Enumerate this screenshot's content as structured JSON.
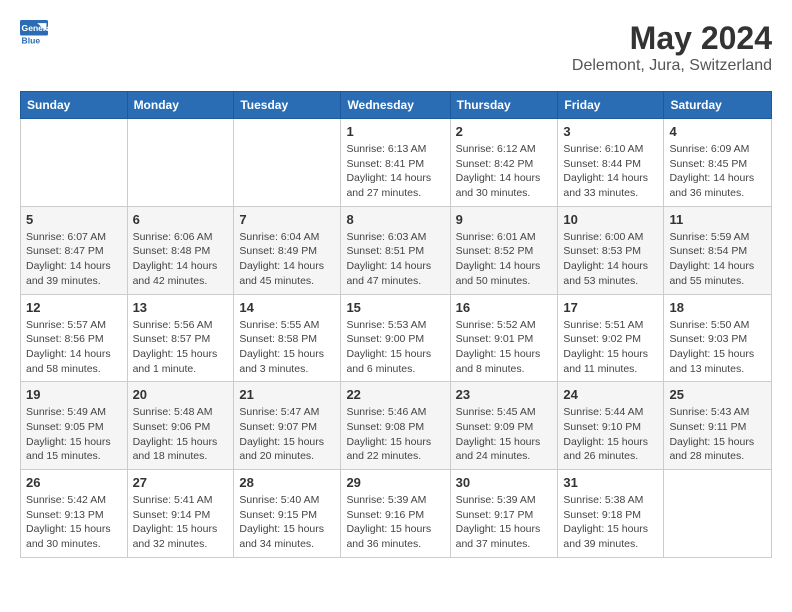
{
  "logo": {
    "general": "General",
    "blue": "Blue"
  },
  "title": "May 2024",
  "subtitle": "Delemont, Jura, Switzerland",
  "days_header": [
    "Sunday",
    "Monday",
    "Tuesday",
    "Wednesday",
    "Thursday",
    "Friday",
    "Saturday"
  ],
  "weeks": [
    [
      {
        "day": "",
        "info": ""
      },
      {
        "day": "",
        "info": ""
      },
      {
        "day": "",
        "info": ""
      },
      {
        "day": "1",
        "info": "Sunrise: 6:13 AM\nSunset: 8:41 PM\nDaylight: 14 hours\nand 27 minutes."
      },
      {
        "day": "2",
        "info": "Sunrise: 6:12 AM\nSunset: 8:42 PM\nDaylight: 14 hours\nand 30 minutes."
      },
      {
        "day": "3",
        "info": "Sunrise: 6:10 AM\nSunset: 8:44 PM\nDaylight: 14 hours\nand 33 minutes."
      },
      {
        "day": "4",
        "info": "Sunrise: 6:09 AM\nSunset: 8:45 PM\nDaylight: 14 hours\nand 36 minutes."
      }
    ],
    [
      {
        "day": "5",
        "info": "Sunrise: 6:07 AM\nSunset: 8:47 PM\nDaylight: 14 hours\nand 39 minutes."
      },
      {
        "day": "6",
        "info": "Sunrise: 6:06 AM\nSunset: 8:48 PM\nDaylight: 14 hours\nand 42 minutes."
      },
      {
        "day": "7",
        "info": "Sunrise: 6:04 AM\nSunset: 8:49 PM\nDaylight: 14 hours\nand 45 minutes."
      },
      {
        "day": "8",
        "info": "Sunrise: 6:03 AM\nSunset: 8:51 PM\nDaylight: 14 hours\nand 47 minutes."
      },
      {
        "day": "9",
        "info": "Sunrise: 6:01 AM\nSunset: 8:52 PM\nDaylight: 14 hours\nand 50 minutes."
      },
      {
        "day": "10",
        "info": "Sunrise: 6:00 AM\nSunset: 8:53 PM\nDaylight: 14 hours\nand 53 minutes."
      },
      {
        "day": "11",
        "info": "Sunrise: 5:59 AM\nSunset: 8:54 PM\nDaylight: 14 hours\nand 55 minutes."
      }
    ],
    [
      {
        "day": "12",
        "info": "Sunrise: 5:57 AM\nSunset: 8:56 PM\nDaylight: 14 hours\nand 58 minutes."
      },
      {
        "day": "13",
        "info": "Sunrise: 5:56 AM\nSunset: 8:57 PM\nDaylight: 15 hours\nand 1 minute."
      },
      {
        "day": "14",
        "info": "Sunrise: 5:55 AM\nSunset: 8:58 PM\nDaylight: 15 hours\nand 3 minutes."
      },
      {
        "day": "15",
        "info": "Sunrise: 5:53 AM\nSunset: 9:00 PM\nDaylight: 15 hours\nand 6 minutes."
      },
      {
        "day": "16",
        "info": "Sunrise: 5:52 AM\nSunset: 9:01 PM\nDaylight: 15 hours\nand 8 minutes."
      },
      {
        "day": "17",
        "info": "Sunrise: 5:51 AM\nSunset: 9:02 PM\nDaylight: 15 hours\nand 11 minutes."
      },
      {
        "day": "18",
        "info": "Sunrise: 5:50 AM\nSunset: 9:03 PM\nDaylight: 15 hours\nand 13 minutes."
      }
    ],
    [
      {
        "day": "19",
        "info": "Sunrise: 5:49 AM\nSunset: 9:05 PM\nDaylight: 15 hours\nand 15 minutes."
      },
      {
        "day": "20",
        "info": "Sunrise: 5:48 AM\nSunset: 9:06 PM\nDaylight: 15 hours\nand 18 minutes."
      },
      {
        "day": "21",
        "info": "Sunrise: 5:47 AM\nSunset: 9:07 PM\nDaylight: 15 hours\nand 20 minutes."
      },
      {
        "day": "22",
        "info": "Sunrise: 5:46 AM\nSunset: 9:08 PM\nDaylight: 15 hours\nand 22 minutes."
      },
      {
        "day": "23",
        "info": "Sunrise: 5:45 AM\nSunset: 9:09 PM\nDaylight: 15 hours\nand 24 minutes."
      },
      {
        "day": "24",
        "info": "Sunrise: 5:44 AM\nSunset: 9:10 PM\nDaylight: 15 hours\nand 26 minutes."
      },
      {
        "day": "25",
        "info": "Sunrise: 5:43 AM\nSunset: 9:11 PM\nDaylight: 15 hours\nand 28 minutes."
      }
    ],
    [
      {
        "day": "26",
        "info": "Sunrise: 5:42 AM\nSunset: 9:13 PM\nDaylight: 15 hours\nand 30 minutes."
      },
      {
        "day": "27",
        "info": "Sunrise: 5:41 AM\nSunset: 9:14 PM\nDaylight: 15 hours\nand 32 minutes."
      },
      {
        "day": "28",
        "info": "Sunrise: 5:40 AM\nSunset: 9:15 PM\nDaylight: 15 hours\nand 34 minutes."
      },
      {
        "day": "29",
        "info": "Sunrise: 5:39 AM\nSunset: 9:16 PM\nDaylight: 15 hours\nand 36 minutes."
      },
      {
        "day": "30",
        "info": "Sunrise: 5:39 AM\nSunset: 9:17 PM\nDaylight: 15 hours\nand 37 minutes."
      },
      {
        "day": "31",
        "info": "Sunrise: 5:38 AM\nSunset: 9:18 PM\nDaylight: 15 hours\nand 39 minutes."
      },
      {
        "day": "",
        "info": ""
      }
    ]
  ]
}
